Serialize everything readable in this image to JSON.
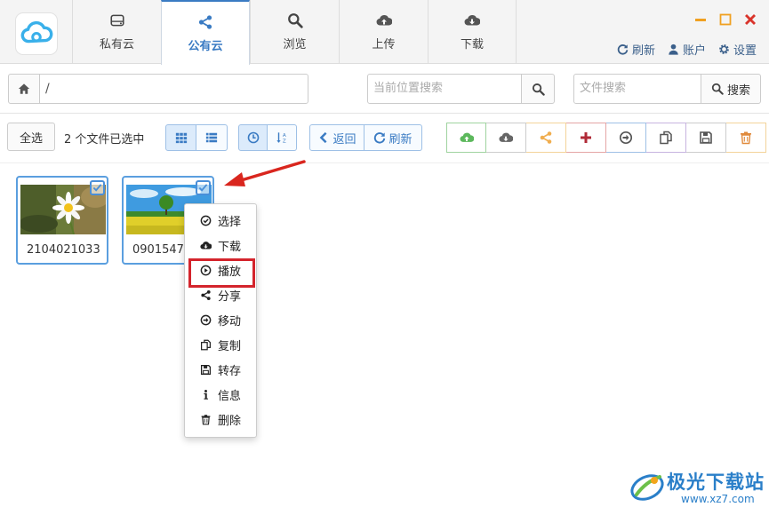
{
  "nav": {
    "tabs": [
      {
        "label": "私有云",
        "icon": "hdd-icon"
      },
      {
        "label": "公有云",
        "icon": "share-icon",
        "active": true
      },
      {
        "label": "浏览",
        "icon": "search-icon"
      },
      {
        "label": "上传",
        "icon": "cloud-upload-icon"
      },
      {
        "label": "下载",
        "icon": "cloud-download-icon"
      }
    ],
    "actions": {
      "refresh": "刷新",
      "account": "账户",
      "settings": "设置"
    }
  },
  "pathbar": {
    "path": "/",
    "location_search_placeholder": "当前位置搜索",
    "file_search_placeholder": "文件搜索",
    "search_label": "搜索"
  },
  "toolbar": {
    "select_all": "全选",
    "selected_count": "2 个文件已选中",
    "back": "返回",
    "refresh": "刷新",
    "actions": [
      "cloud-upload-icon",
      "cloud-download-icon",
      "share-icon",
      "plus-icon",
      "move-icon",
      "copy-icon",
      "save-icon",
      "trash-icon"
    ]
  },
  "files": [
    {
      "name": "2104021033",
      "checked": true
    },
    {
      "name": "09015473",
      "checked": true
    }
  ],
  "context_menu": {
    "items": [
      "选择",
      "下载",
      "播放",
      "分享",
      "移动",
      "复制",
      "转存",
      "信息",
      "删除"
    ],
    "highlighted": "播放"
  },
  "watermark": {
    "title": "极光下载站",
    "url": "www.xz7.com"
  },
  "colors": {
    "accent": "#3a7bc3",
    "highlight": "#d4242c",
    "upload": "#5cb85c",
    "share": "#f0ad4e",
    "add": "#c9302c"
  }
}
